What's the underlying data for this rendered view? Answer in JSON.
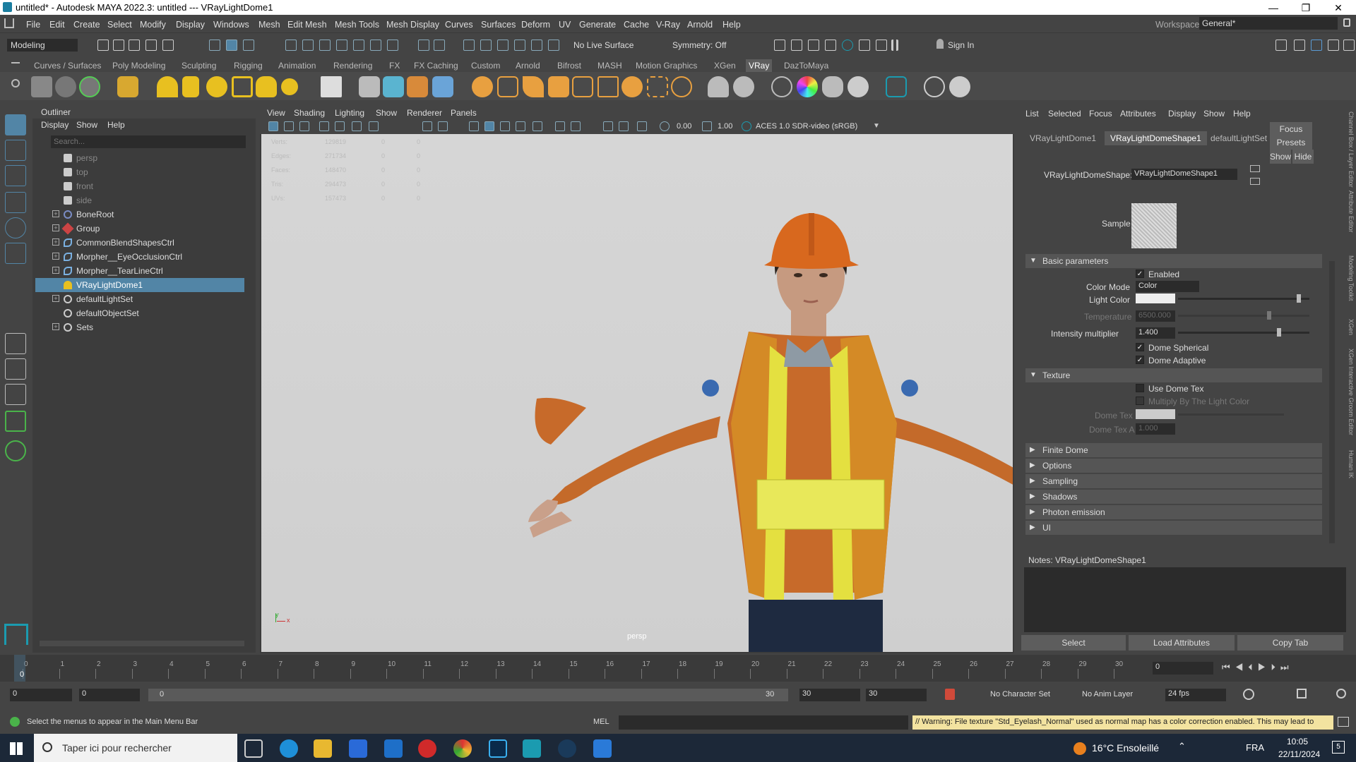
{
  "window": {
    "title": "untitled* - Autodesk MAYA 2022.3: untitled  ---  VRayLightDome1",
    "min": "—",
    "max": "❐",
    "close": "✕"
  },
  "menubar": [
    "File",
    "Edit",
    "Create",
    "Select",
    "Modify",
    "Display",
    "Windows",
    "Mesh",
    "Edit Mesh",
    "Mesh Tools",
    "Mesh Display",
    "Curves",
    "Surfaces",
    "Deform",
    "UV",
    "Generate",
    "Cache",
    "V-Ray",
    "Arnold",
    "Help"
  ],
  "workspace": {
    "label": "Workspace:",
    "value": "General*"
  },
  "statusline": {
    "mode": "Modeling",
    "live_surface": "No Live Surface",
    "symmetry": "Symmetry: Off",
    "sign_in": "Sign In"
  },
  "shelf_tabs": [
    "Curves / Surfaces",
    "Poly Modeling",
    "Sculpting",
    "Rigging",
    "Animation",
    "Rendering",
    "FX",
    "FX Caching",
    "Custom",
    "Arnold",
    "Bifrost",
    "MASH",
    "Motion Graphics",
    "XGen",
    "VRay",
    "DazToMaya"
  ],
  "shelf_active": "VRay",
  "outliner": {
    "title": "Outliner",
    "menu": [
      "Display",
      "Show",
      "Help"
    ],
    "search_placeholder": "Search...",
    "items": [
      {
        "label": "persp",
        "type": "camera",
        "dim": true,
        "expand": false
      },
      {
        "label": "top",
        "type": "camera",
        "dim": true,
        "expand": false
      },
      {
        "label": "front",
        "type": "camera",
        "dim": true,
        "expand": false
      },
      {
        "label": "side",
        "type": "camera",
        "dim": true,
        "expand": false
      },
      {
        "label": "BoneRoot",
        "type": "joint",
        "dim": false,
        "expand": true
      },
      {
        "label": "Group",
        "type": "group",
        "dim": false,
        "expand": true
      },
      {
        "label": "CommonBlendShapesCtrl",
        "type": "curve",
        "dim": false,
        "expand": true
      },
      {
        "label": "Morpher__EyeOcclusionCtrl",
        "type": "curve",
        "dim": false,
        "expand": true
      },
      {
        "label": "Morpher__TearLineCtrl",
        "type": "curve",
        "dim": false,
        "expand": true
      },
      {
        "label": "VRayLightDome1",
        "type": "light",
        "dim": false,
        "expand": false,
        "selected": true
      },
      {
        "label": "defaultLightSet",
        "type": "set",
        "dim": false,
        "expand": true
      },
      {
        "label": "defaultObjectSet",
        "type": "set",
        "dim": false,
        "expand": false
      },
      {
        "label": "Sets",
        "type": "set",
        "dim": false,
        "expand": true
      }
    ]
  },
  "viewport": {
    "menu": [
      "View",
      "Shading",
      "Lighting",
      "Show",
      "Renderer",
      "Panels"
    ],
    "exposure": "0.00",
    "gamma": "1.00",
    "color_space": "ACES 1.0 SDR-video (sRGB)",
    "hud_labels": [
      "Verts:",
      "Edges:",
      "Faces:",
      "Tris:",
      "UVs:"
    ],
    "hud_values": [
      "129819",
      "271734",
      "148470",
      "294473",
      "157473"
    ],
    "hud_zero": "0",
    "camera_name": "persp",
    "axis_y": "y",
    "axis_x": "x"
  },
  "attribute_editor": {
    "menu": [
      "List",
      "Selected",
      "Focus",
      "Attributes",
      "Display",
      "Show",
      "Help"
    ],
    "tabs": [
      "VRayLightDome1",
      "VRayLightDomeShape1",
      "defaultLightSet"
    ],
    "active_tab": "VRayLightDomeShape1",
    "node_label": "VRayLightDomeShape:",
    "node_value": "VRayLightDomeShape1",
    "focus": "Focus",
    "presets": "Presets",
    "show": "Show",
    "hide": "Hide",
    "sample_label": "Sample",
    "sections": {
      "basic": "Basic parameters",
      "texture": "Texture",
      "finite_dome": "Finite Dome",
      "options": "Options",
      "sampling": "Sampling",
      "shadows": "Shadows",
      "photon": "Photon emission",
      "ui": "UI"
    },
    "enabled": "Enabled",
    "color_mode_label": "Color Mode",
    "color_mode_value": "Color",
    "light_color_label": "Light Color",
    "temperature_label": "Temperature",
    "temperature_value": "6500.000",
    "intensity_label": "Intensity multiplier",
    "intensity_value": "1.400",
    "dome_spherical": "Dome Spherical",
    "dome_adaptive": "Dome Adaptive",
    "use_dome_tex": "Use Dome Tex",
    "multiply_by": "Multiply By The Light Color",
    "dome_tex_label": "Dome Tex",
    "dome_tex_a_label": "Dome Tex A",
    "dome_tex_a_value": "1.000",
    "notes": "Notes:  VRayLightDomeShape1",
    "select": "Select",
    "load": "Load Attributes",
    "copy": "Copy Tab",
    "side_tabs": [
      "Channel Box / Layer Editor",
      "Attribute Editor",
      "Modeling Toolkit",
      "XGen",
      "XGen Interactive Groom Editor",
      "Human IK"
    ]
  },
  "timeline": {
    "ticks": [
      "0",
      "1",
      "2",
      "3",
      "4",
      "5",
      "6",
      "7",
      "8",
      "9",
      "10",
      "11",
      "12",
      "13",
      "14",
      "15",
      "16",
      "17",
      "18",
      "19",
      "20",
      "21",
      "22",
      "23",
      "24",
      "25",
      "26",
      "27",
      "28",
      "29",
      "30"
    ],
    "current": "0",
    "current_frame_field": "0"
  },
  "range": {
    "start": "0",
    "inner_start": "0",
    "slider_start": "0",
    "slider_end": "30",
    "end": "30",
    "outer_end": "30",
    "character_set": "No Character Set",
    "anim_layer": "No Anim Layer",
    "fps": "24 fps"
  },
  "command": {
    "help_text": "Select the menus to appear in the Main Menu Bar",
    "mel": "MEL",
    "warning": "// Warning: File texture \"Std_Eyelash_Normal\" used as normal map has a color correction enabled. This may lead to"
  },
  "taskbar": {
    "search_placeholder": "Taper ici pour rechercher",
    "weather": "16°C Ensoleillé",
    "lang": "FRA",
    "time": "10:05",
    "date": "22/11/2024",
    "notif": "5"
  },
  "colors": {
    "selection": "#5285a6",
    "accent_yellow": "#e8c020",
    "maya_teal": "#1b9bb0",
    "warning_bg": "#f3e3a0"
  }
}
